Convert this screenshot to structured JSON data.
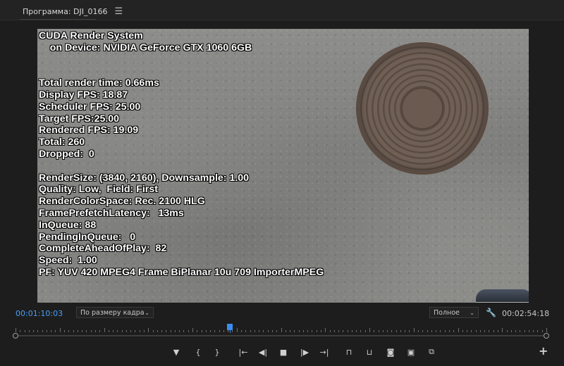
{
  "panel": {
    "title": "Программа: DJI_0166",
    "menu_icon": "hamburger-menu-icon"
  },
  "overlay": {
    "lines": [
      "CUDA Render System",
      "    on Device: NVIDIA GeForce GTX 1060 6GB",
      "",
      "",
      "Total render time: 0.66ms",
      "Display FPS: 18.87",
      "Scheduler FPS: 25.00",
      "Target FPS:25.00",
      "Rendered FPS: 19.09",
      "Total: 260",
      "Dropped:  0",
      "",
      "RenderSize: (3840, 2160), Downsample: 1.00",
      "Quality: Low,  Field: First",
      "RenderColorSpace: Rec. 2100 HLG",
      "FramePrefetchLatency:   13ms",
      "InQueue: 88",
      "PendingInQueue:   0",
      "CompleteAheadOfPlay:  82",
      "Speed:  1.00",
      "PF: YUV 420 MPEG4 Frame BiPlanar 10u 709 ImporterMPEG"
    ]
  },
  "controls": {
    "current_timecode": "00:01:10:03",
    "zoom_select": "По размеру кадра",
    "quality_select": "Полное",
    "duration_timecode": "00:02:54:18",
    "playhead_position": 0.404,
    "accent_color": "#3b8ef0"
  },
  "transport": [
    {
      "name": "add-marker-button",
      "glyph": "▼",
      "icon": "marker-icon"
    },
    {
      "name": "mark-in-button",
      "glyph": "{",
      "icon": "mark-in-icon"
    },
    {
      "name": "mark-out-button",
      "glyph": "}",
      "icon": "mark-out-icon"
    },
    {
      "name": "go-to-in-button",
      "glyph": "|←",
      "icon": "go-to-in-icon"
    },
    {
      "name": "step-back-button",
      "glyph": "◀|",
      "icon": "step-back-icon"
    },
    {
      "name": "stop-button",
      "glyph": "■",
      "icon": "stop-icon"
    },
    {
      "name": "step-forward-button",
      "glyph": "|▶",
      "icon": "step-forward-icon"
    },
    {
      "name": "go-to-out-button",
      "glyph": "→|",
      "icon": "go-to-out-icon"
    },
    {
      "name": "lift-button",
      "glyph": "⊓",
      "icon": "lift-icon"
    },
    {
      "name": "extract-button",
      "glyph": "⊔",
      "icon": "extract-icon"
    },
    {
      "name": "export-frame-button",
      "glyph": "◙",
      "icon": "camera-icon"
    },
    {
      "name": "comparison-view-button",
      "glyph": "▣",
      "icon": "comparison-view-icon"
    },
    {
      "name": "multi-camera-button",
      "glyph": "⧉",
      "icon": "multi-camera-icon"
    }
  ],
  "button_editor_icon": "plus-icon"
}
